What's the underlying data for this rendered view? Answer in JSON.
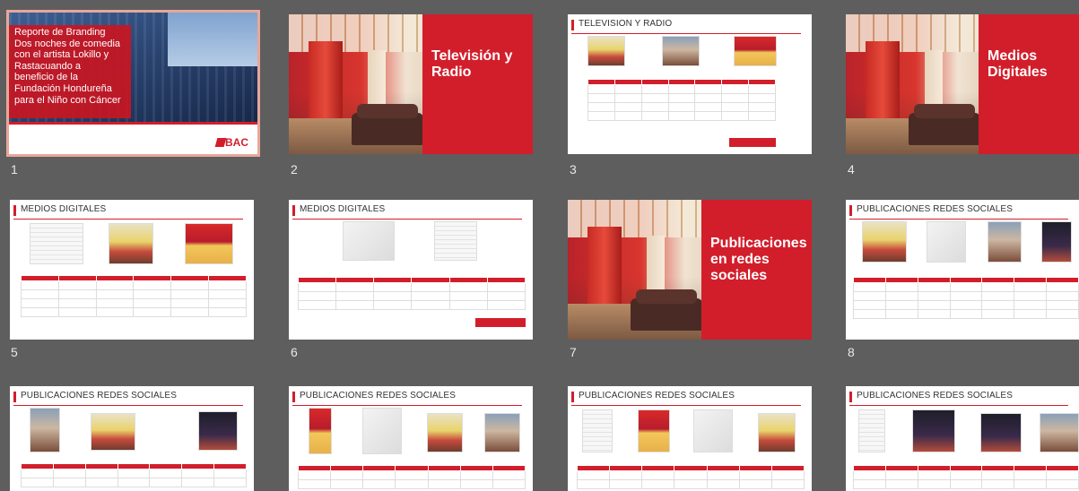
{
  "colors": {
    "background": "#5e5e5e",
    "brand_red": "#d21e2b",
    "selection": "#e8a79a",
    "slide_number": "#e8e8e8"
  },
  "slides": [
    {
      "number": "1",
      "kind": "title",
      "selected": true,
      "title_lines": [
        "Reporte de Branding",
        "Dos noches de comedia",
        "con el artista Lokillo y",
        "Rastacuando a",
        "beneficio de la",
        "Fundación Hondureña",
        "para el Niño con Cáncer"
      ],
      "logo": "BAC"
    },
    {
      "number": "2",
      "kind": "section",
      "title": "Televisión y Radio"
    },
    {
      "number": "3",
      "kind": "content",
      "title": "TELEVISION Y RADIO"
    },
    {
      "number": "4",
      "kind": "section",
      "title": "Medios Digitales"
    },
    {
      "number": "5",
      "kind": "content",
      "title": "MEDIOS DIGITALES"
    },
    {
      "number": "6",
      "kind": "content",
      "title": "MEDIOS DIGITALES"
    },
    {
      "number": "7",
      "kind": "section",
      "title": "Publicaciones en redes sociales"
    },
    {
      "number": "8",
      "kind": "content",
      "title": "PUBLICACIONES REDES SOCIALES"
    },
    {
      "number": "",
      "kind": "content",
      "title": "PUBLICACIONES REDES SOCIALES"
    },
    {
      "number": "",
      "kind": "content",
      "title": "PUBLICACIONES REDES SOCIALES"
    },
    {
      "number": "",
      "kind": "content",
      "title": "PUBLICACIONES REDES SOCIALES"
    },
    {
      "number": "",
      "kind": "content",
      "title": "PUBLICACIONES REDES SOCIALES"
    }
  ]
}
